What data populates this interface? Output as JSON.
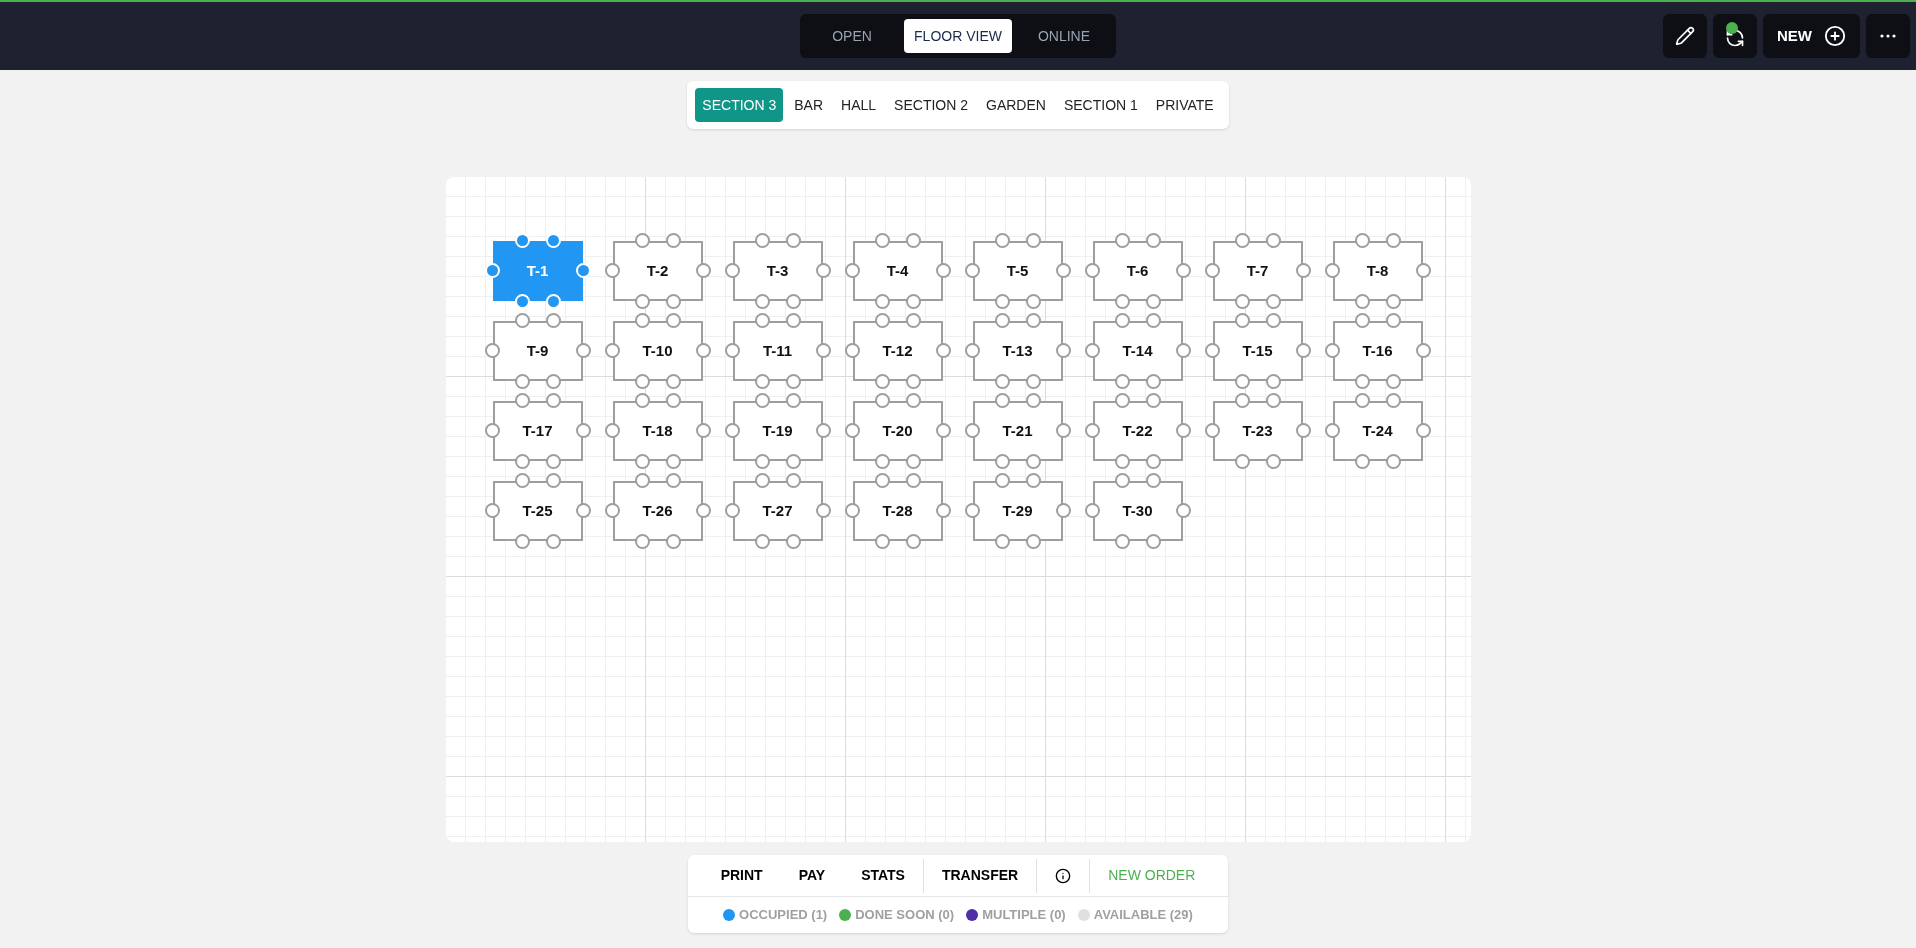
{
  "mode_tabs": [
    {
      "label": "OPEN",
      "selected": false
    },
    {
      "label": "FLOOR VIEW",
      "selected": true
    },
    {
      "label": "ONLINE",
      "selected": false
    }
  ],
  "new_button": {
    "label": "NEW"
  },
  "sections": [
    {
      "label": "SECTION 3",
      "selected": true
    },
    {
      "label": "BAR",
      "selected": false
    },
    {
      "label": "HALL",
      "selected": false
    },
    {
      "label": "SECTION 2",
      "selected": false
    },
    {
      "label": "GARDEN",
      "selected": false
    },
    {
      "label": "SECTION 1",
      "selected": false
    },
    {
      "label": "PRIVATE",
      "selected": false
    }
  ],
  "tables": [
    {
      "label": "T-1",
      "kind": "occupied"
    },
    {
      "label": "T-2",
      "kind": "available"
    },
    {
      "label": "T-3",
      "kind": "available"
    },
    {
      "label": "T-4",
      "kind": "available"
    },
    {
      "label": "T-5",
      "kind": "available"
    },
    {
      "label": "T-6",
      "kind": "available"
    },
    {
      "label": "T-7",
      "kind": "available"
    },
    {
      "label": "T-8",
      "kind": "available"
    },
    {
      "label": "T-9",
      "kind": "available"
    },
    {
      "label": "T-10",
      "kind": "available"
    },
    {
      "label": "T-11",
      "kind": "available"
    },
    {
      "label": "T-12",
      "kind": "available"
    },
    {
      "label": "T-13",
      "kind": "available"
    },
    {
      "label": "T-14",
      "kind": "available"
    },
    {
      "label": "T-15",
      "kind": "available"
    },
    {
      "label": "T-16",
      "kind": "available"
    },
    {
      "label": "T-17",
      "kind": "available"
    },
    {
      "label": "T-18",
      "kind": "available"
    },
    {
      "label": "T-19",
      "kind": "available"
    },
    {
      "label": "T-20",
      "kind": "available"
    },
    {
      "label": "T-21",
      "kind": "available"
    },
    {
      "label": "T-22",
      "kind": "available"
    },
    {
      "label": "T-23",
      "kind": "available"
    },
    {
      "label": "T-24",
      "kind": "available"
    },
    {
      "label": "T-25",
      "kind": "available"
    },
    {
      "label": "T-26",
      "kind": "available"
    },
    {
      "label": "T-27",
      "kind": "available"
    },
    {
      "label": "T-28",
      "kind": "available"
    },
    {
      "label": "T-29",
      "kind": "available"
    },
    {
      "label": "T-30",
      "kind": "available"
    }
  ],
  "actions": [
    {
      "kind": "text",
      "label": "PRINT"
    },
    {
      "kind": "text",
      "label": "PAY"
    },
    {
      "kind": "text",
      "label": "STATS"
    },
    {
      "kind": "divider"
    },
    {
      "kind": "text",
      "label": "TRANSFER"
    },
    {
      "kind": "divider"
    },
    {
      "kind": "info"
    },
    {
      "kind": "divider"
    },
    {
      "kind": "accent",
      "label": "NEW ORDER"
    }
  ],
  "legend": [
    {
      "label": "OCCUPIED (1)",
      "color": "#2196f3"
    },
    {
      "label": "DONE SOON (0)",
      "color": "#4caf50"
    },
    {
      "label": "MULTIPLE (0)",
      "color": "#512da8"
    },
    {
      "label": "AVAILABLE (29)",
      "color": "#e0e0e0"
    }
  ]
}
